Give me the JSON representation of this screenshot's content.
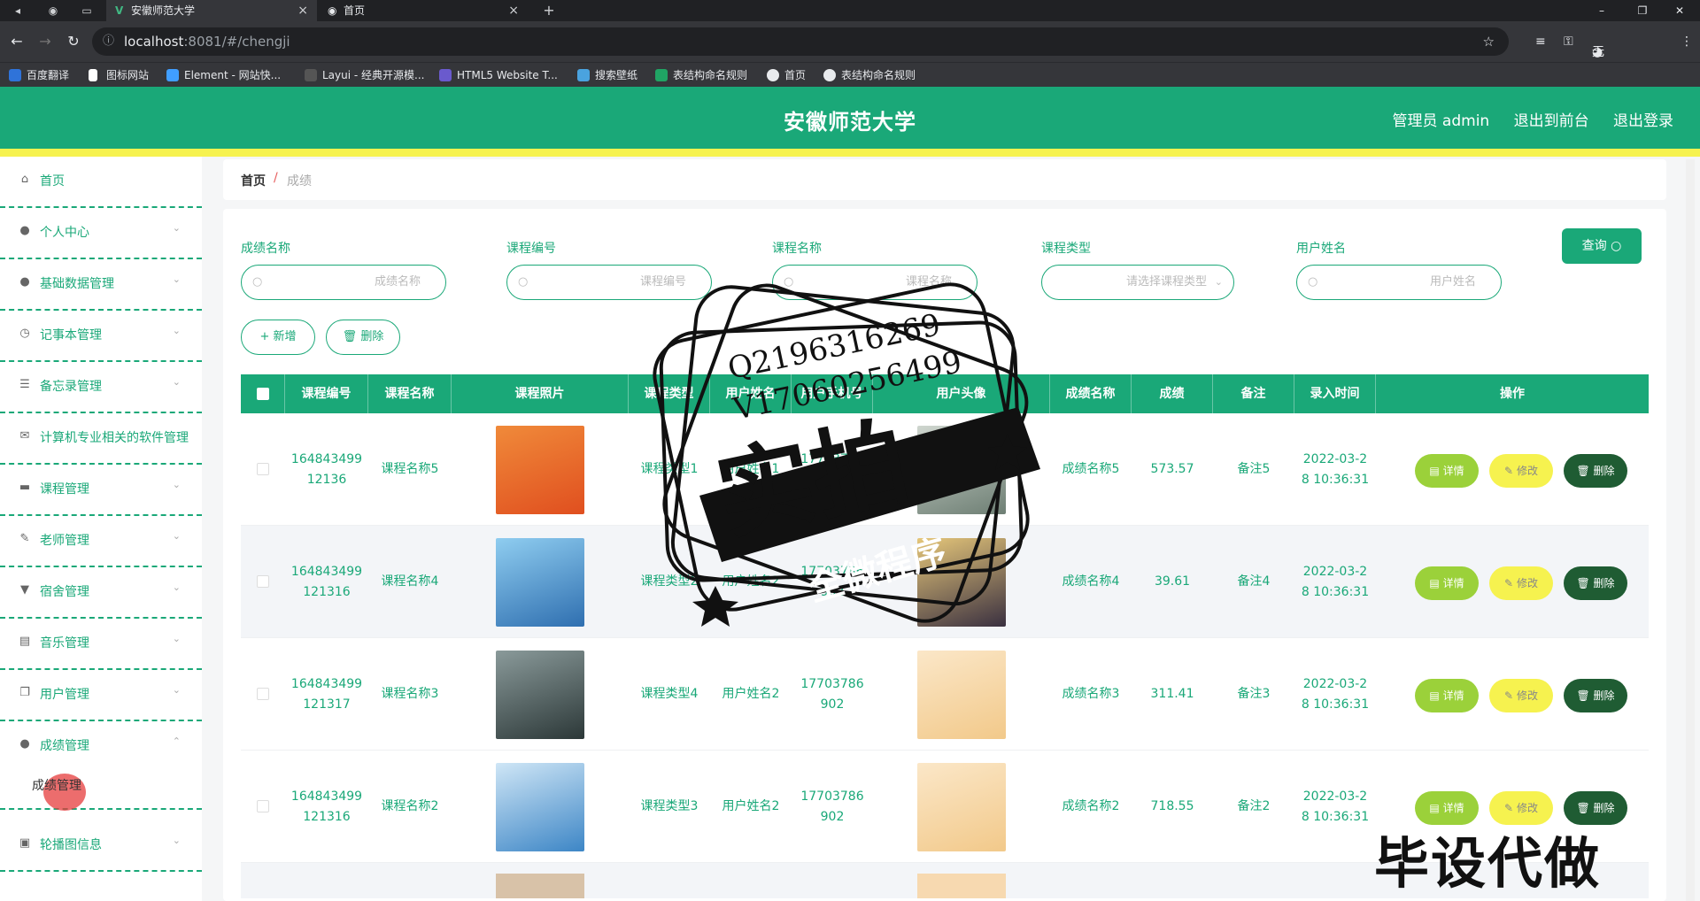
{
  "browser": {
    "tabs": [
      {
        "title": "安徽师范大学",
        "close": "×"
      },
      {
        "title": "首页",
        "close": "×"
      }
    ],
    "new_tab": "+",
    "window_controls": [
      "–",
      "❐",
      "✕"
    ],
    "url_host": "localhost",
    "url_path": ":8081/#/chengji",
    "incognito_label": "无痕模式",
    "bookmarks": [
      {
        "label": "百度翻译",
        "color": "#2f73d9"
      },
      {
        "label": "图标网站",
        "color": "#ffffff"
      },
      {
        "label": "Element - 网站快...",
        "color": "#409eff"
      },
      {
        "label": "Layui - 经典开源模...",
        "color": "#2f2f2f"
      },
      {
        "label": "HTML5 Website T...",
        "color": "#6a5acd"
      },
      {
        "label": "搜索壁纸",
        "color": "#4aa3df"
      },
      {
        "label": "表结构命名规则",
        "color": "#20a464"
      },
      {
        "label": "首页",
        "color": "#e8eaed"
      },
      {
        "label": "表结构命名规则",
        "color": "#e8eaed"
      }
    ]
  },
  "header": {
    "title": "安徽师范大学",
    "admin": "管理员 admin",
    "to_front": "退出到前台",
    "logout": "退出登录",
    "accent": "#1aa878",
    "stripe": "#f6f24f"
  },
  "sidebar": {
    "items": [
      {
        "label": "首页",
        "icon": "home-icon",
        "glyph": "⌂",
        "arrow": ""
      },
      {
        "label": "个人中心",
        "icon": "user-icon",
        "glyph": "●",
        "arrow": "⌄"
      },
      {
        "label": "基础数据管理",
        "icon": "user-icon",
        "glyph": "●",
        "arrow": "⌄"
      },
      {
        "label": "记事本管理",
        "icon": "clock-icon",
        "glyph": "◷",
        "arrow": "⌄"
      },
      {
        "label": "备忘录管理",
        "icon": "sliders-icon",
        "glyph": "☰",
        "arrow": "⌄"
      },
      {
        "label": "计算机专业相关的软件管理",
        "icon": "mail-icon",
        "glyph": "✉",
        "arrow": ""
      },
      {
        "label": "课程管理",
        "icon": "briefcase-icon",
        "glyph": "▬",
        "arrow": "⌄"
      },
      {
        "label": "老师管理",
        "icon": "edit-icon",
        "glyph": "✎",
        "arrow": "⌄"
      },
      {
        "label": "宿舍管理",
        "icon": "trophy-icon",
        "glyph": "▼",
        "arrow": "⌄"
      },
      {
        "label": "音乐管理",
        "icon": "storage-icon",
        "glyph": "▤",
        "arrow": "⌄"
      },
      {
        "label": "用户管理",
        "icon": "copy-icon",
        "glyph": "❐",
        "arrow": "⌄"
      },
      {
        "label": "成绩管理",
        "icon": "user-icon",
        "glyph": "●",
        "arrow": "⌃"
      },
      {
        "label": "轮播图信息",
        "icon": "picture-icon",
        "glyph": "▣",
        "arrow": "⌄"
      }
    ],
    "sub_item": "成绩管理"
  },
  "breadcrumb": {
    "home": "首页",
    "sep": "/",
    "current": "成绩"
  },
  "filters": [
    {
      "label": "成绩名称",
      "placeholder": "成绩名称",
      "dropdown": false
    },
    {
      "label": "课程编号",
      "placeholder": "课程编号",
      "dropdown": false
    },
    {
      "label": "课程名称",
      "placeholder": "课程名称",
      "dropdown": false
    },
    {
      "label": "课程类型",
      "placeholder": "请选择课程类型",
      "dropdown": true
    },
    {
      "label": "用户姓名",
      "placeholder": "用户姓名",
      "dropdown": false
    }
  ],
  "query_btn": "查询",
  "add_btn": "+ 新增",
  "delete_btn": "删除",
  "table": {
    "headers": [
      "课程编号",
      "课程名称",
      "课程照片",
      "课程类型",
      "用户姓名",
      "用户手机号",
      "用户头像",
      "成绩名称",
      "成绩",
      "备注",
      "录入时间",
      "操作"
    ],
    "op_labels": {
      "detail": "详情",
      "edit": "修改",
      "del": "删除"
    },
    "rows": [
      {
        "code": "164843499\n12136",
        "name": "课程名称5",
        "type": "课程类型1",
        "user": "用户姓名1",
        "phone": "17703786\n901",
        "grade_name": "成绩名称5",
        "score": "573.57",
        "note": "备注5",
        "time": "2022-03-2\n8 10:36:31",
        "photo_color": "#e8652a",
        "avatar_color": "#7a8a7f"
      },
      {
        "code": "164843499\n121316",
        "name": "课程名称4",
        "type": "课程类型2",
        "user": "用户姓名2",
        "phone": "17703786\n902",
        "grade_name": "成绩名称4",
        "score": "39.61",
        "note": "备注4",
        "time": "2022-03-2\n8 10:36:31",
        "photo_color": "#5aa0d0",
        "avatar_color": "#3a3040"
      },
      {
        "code": "164843499\n121317",
        "name": "课程名称3",
        "type": "课程类型4",
        "user": "用户姓名2",
        "phone": "17703786\n902",
        "grade_name": "成绩名称3",
        "score": "311.41",
        "note": "备注3",
        "time": "2022-03-2\n8 10:36:31",
        "photo_color": "#3a4a4a",
        "avatar_color": "#f7d9b0"
      },
      {
        "code": "164843499\n121316",
        "name": "课程名称2",
        "type": "课程类型3",
        "user": "用户姓名2",
        "phone": "17703786\n902",
        "grade_name": "成绩名称2",
        "score": "718.55",
        "note": "备注2",
        "time": "2022-03-2\n8 10:36:31",
        "photo_color": "#4a9ad6",
        "avatar_color": "#f7d9b0"
      }
    ]
  },
  "watermark": {
    "line1": "Q2196316269",
    "line2": "V17060256499",
    "big": "实拍",
    "banner": "全微程序",
    "bottom": "毕设代做"
  }
}
